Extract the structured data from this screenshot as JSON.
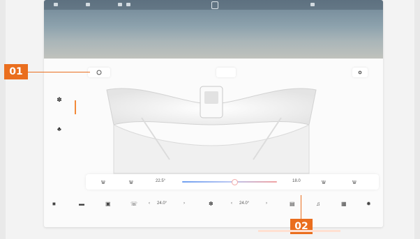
{
  "status_bar": {
    "left_texts": [
      "",
      "",
      ""
    ],
    "right_texts": [
      "",
      "",
      ""
    ]
  },
  "controls": {
    "power_icon": "power-icon",
    "mode_label": "",
    "settings_icon": "gear-icon"
  },
  "left_nav": [
    {
      "icon": "fan-icon",
      "label": ""
    },
    {
      "icon": "seat-icon",
      "label": ""
    }
  ],
  "temperature_bar": {
    "left_temp": "22.5°",
    "right_temp": "18.0",
    "slider_level": 0.55,
    "colors": {
      "cool": "#6f9ff0",
      "warm": "#f1a3a3"
    }
  },
  "dock": {
    "left_temp": "24.0°",
    "right_temp": "24.0°",
    "items": [
      "car-icon",
      "car-front-icon",
      "seat-heat-icon",
      "phone-icon",
      "fan-icon",
      "music-icon",
      "apps-icon",
      "settings-icon"
    ]
  },
  "callouts": {
    "one": "01",
    "two": "02"
  },
  "accent": "#ea6e1e"
}
